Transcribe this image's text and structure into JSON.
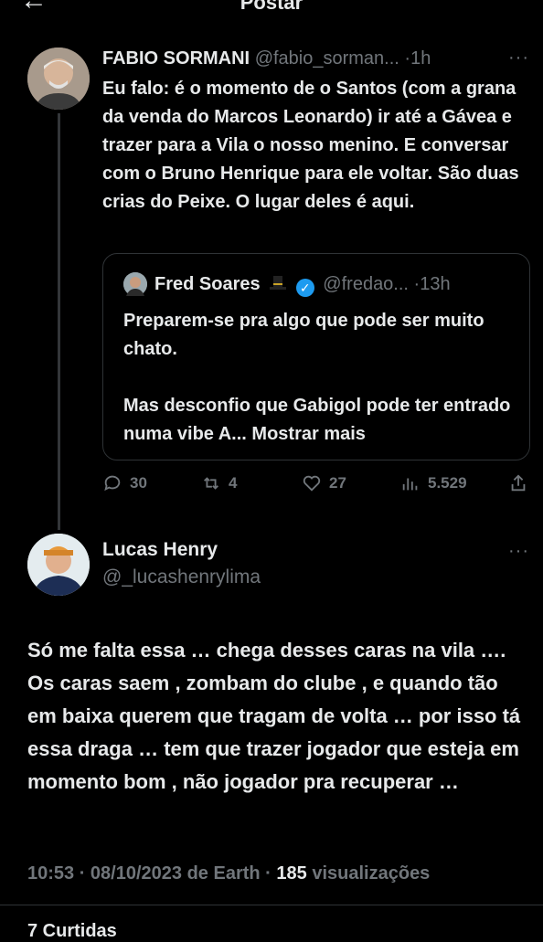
{
  "header": {
    "back_icon": "arrow-left-icon",
    "title": "Postar"
  },
  "original_post": {
    "author_name": "FABIO SORMANI",
    "handle": "@fabio_sorman...",
    "separator": "·",
    "time": "1h",
    "more_label": "···",
    "text": "Eu falo: é o momento de o Santos (com a grana da venda do Marcos Leonardo) ir até a Gávea e trazer para a Vila o nosso menino. E conversar com o Bruno Henrique para ele voltar. São duas crias do Peixe. O lugar deles é aqui.",
    "quote": {
      "author_name": "Fred Soares",
      "emoji_icon": "top-hat-icon",
      "verified_icon": "verified-badge-icon",
      "handle": "@fredao...",
      "separator": "·",
      "time": "13h",
      "text_line1": "Preparem-se pra algo que pode ser muito chato.",
      "text_line2": "Mas desconfio que Gabigol pode ter entrado numa vibe A...",
      "show_more": "Mostrar mais"
    },
    "actions": {
      "replies": "30",
      "reposts": "4",
      "likes": "27",
      "views": "5.529"
    }
  },
  "reply_post": {
    "author_name": "Lucas Henry",
    "handle": "@_lucashenrylima",
    "more_label": "···",
    "text": "Só me falta essa … chega desses caras na vila …. Os caras saem , zombam do clube , e quando tão em baixa querem que tragam de volta … por isso tá essa draga … tem que trazer jogador que esteja em momento bom , não jogador pra recuperar …",
    "timestamp": "10:53 · 08/10/2023 de Earth",
    "separator": "·",
    "views_count": "185",
    "views_label": "visualizações"
  },
  "footer": {
    "likes_text": "7 Curtidas"
  },
  "colors": {
    "background": "#000000",
    "text": "#e7e9ea",
    "muted": "#71767b",
    "verified": "#1d9bf0",
    "border": "#2f3336"
  }
}
